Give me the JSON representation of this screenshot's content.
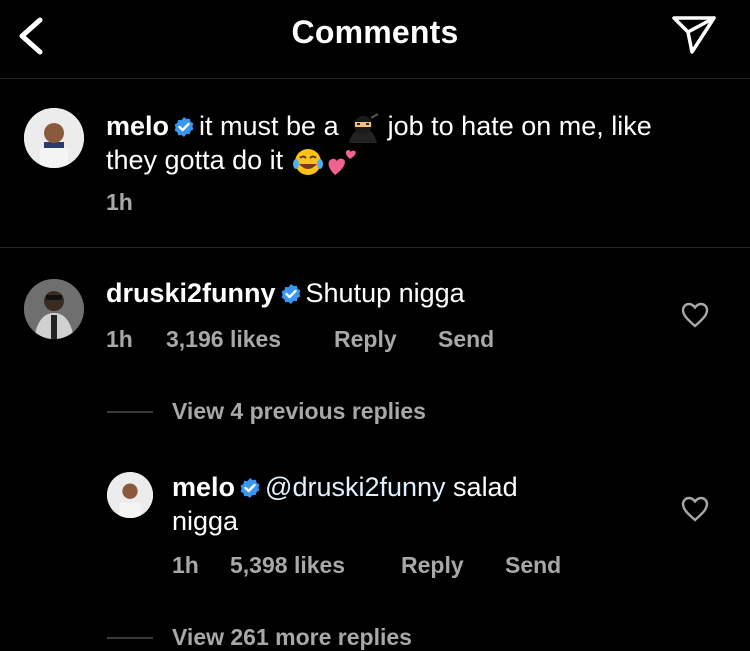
{
  "header": {
    "title": "Comments",
    "back_icon": "chevron-left-icon",
    "share_icon": "paper-plane-icon"
  },
  "caption": {
    "username": "melo",
    "text_a": "it must be a",
    "text_b": "job to hate on me, like",
    "text_c": "they gotta do it",
    "time": "1h",
    "emojis": [
      "ninja-emoji",
      "tears-of-joy-emoji",
      "two-hearts-emoji"
    ]
  },
  "comment": {
    "username": "druski2funny",
    "text": "Shutup nigga",
    "time": "1h",
    "likes": "3,196 likes",
    "reply": "Reply",
    "send": "Send"
  },
  "view_previous": "View 4 previous replies",
  "reply": {
    "username": "melo",
    "mention": "@druski2funny",
    "text_a": "salad",
    "text_b": "nigga",
    "time": "1h",
    "likes": "5,398 likes",
    "reply": "Reply",
    "send": "Send"
  },
  "view_more": "View 261 more replies",
  "colors": {
    "background": "#000000",
    "verified": "#3897f0",
    "secondary": "#a8a8a8",
    "mention": "#e0f1ff"
  }
}
